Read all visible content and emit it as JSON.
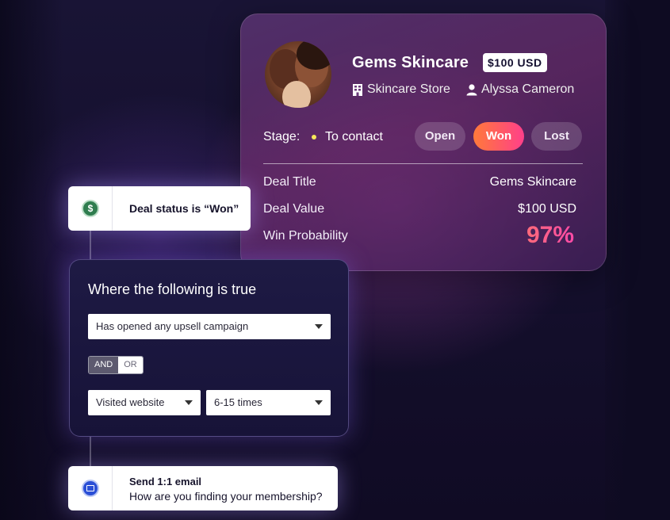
{
  "deal": {
    "company": "Gems Skincare",
    "amount_badge": "$100 USD",
    "store": "Skincare Store",
    "owner": "Alyssa Cameron",
    "stage_label": "Stage:",
    "stage_value": "To contact",
    "stage_dot_color": "#f7e85a",
    "status_buttons": {
      "open": "Open",
      "won": "Won",
      "lost": "Lost"
    },
    "rows": [
      {
        "label": "Deal Title",
        "value": "Gems Skincare"
      },
      {
        "label": "Deal Value",
        "value": "$100 USD"
      },
      {
        "label": "Win Probability",
        "value": "97%"
      }
    ],
    "icons": {
      "store": "building-icon",
      "owner": "person-icon"
    }
  },
  "flow": {
    "trigger": {
      "text": "Deal status is “Won”",
      "icon": "dollar-icon",
      "icon_color": "#2f7d4f"
    },
    "condition": {
      "title": "Where the following is true",
      "campaign_select": "Has opened any upsell campaign",
      "logic_and": "AND",
      "logic_or": "OR",
      "visited_select": "Visited website",
      "times_select": "6-15 times"
    },
    "action": {
      "title": "Send 1:1 email",
      "subtitle": "How are you finding your membership?",
      "icon": "email-icon",
      "icon_color": "#2a4fd6"
    }
  },
  "colors": {
    "won_gradient_start": "#ff7a3a",
    "won_gradient_end": "#ff3f8a",
    "win_probability": "#ff4aa8"
  }
}
